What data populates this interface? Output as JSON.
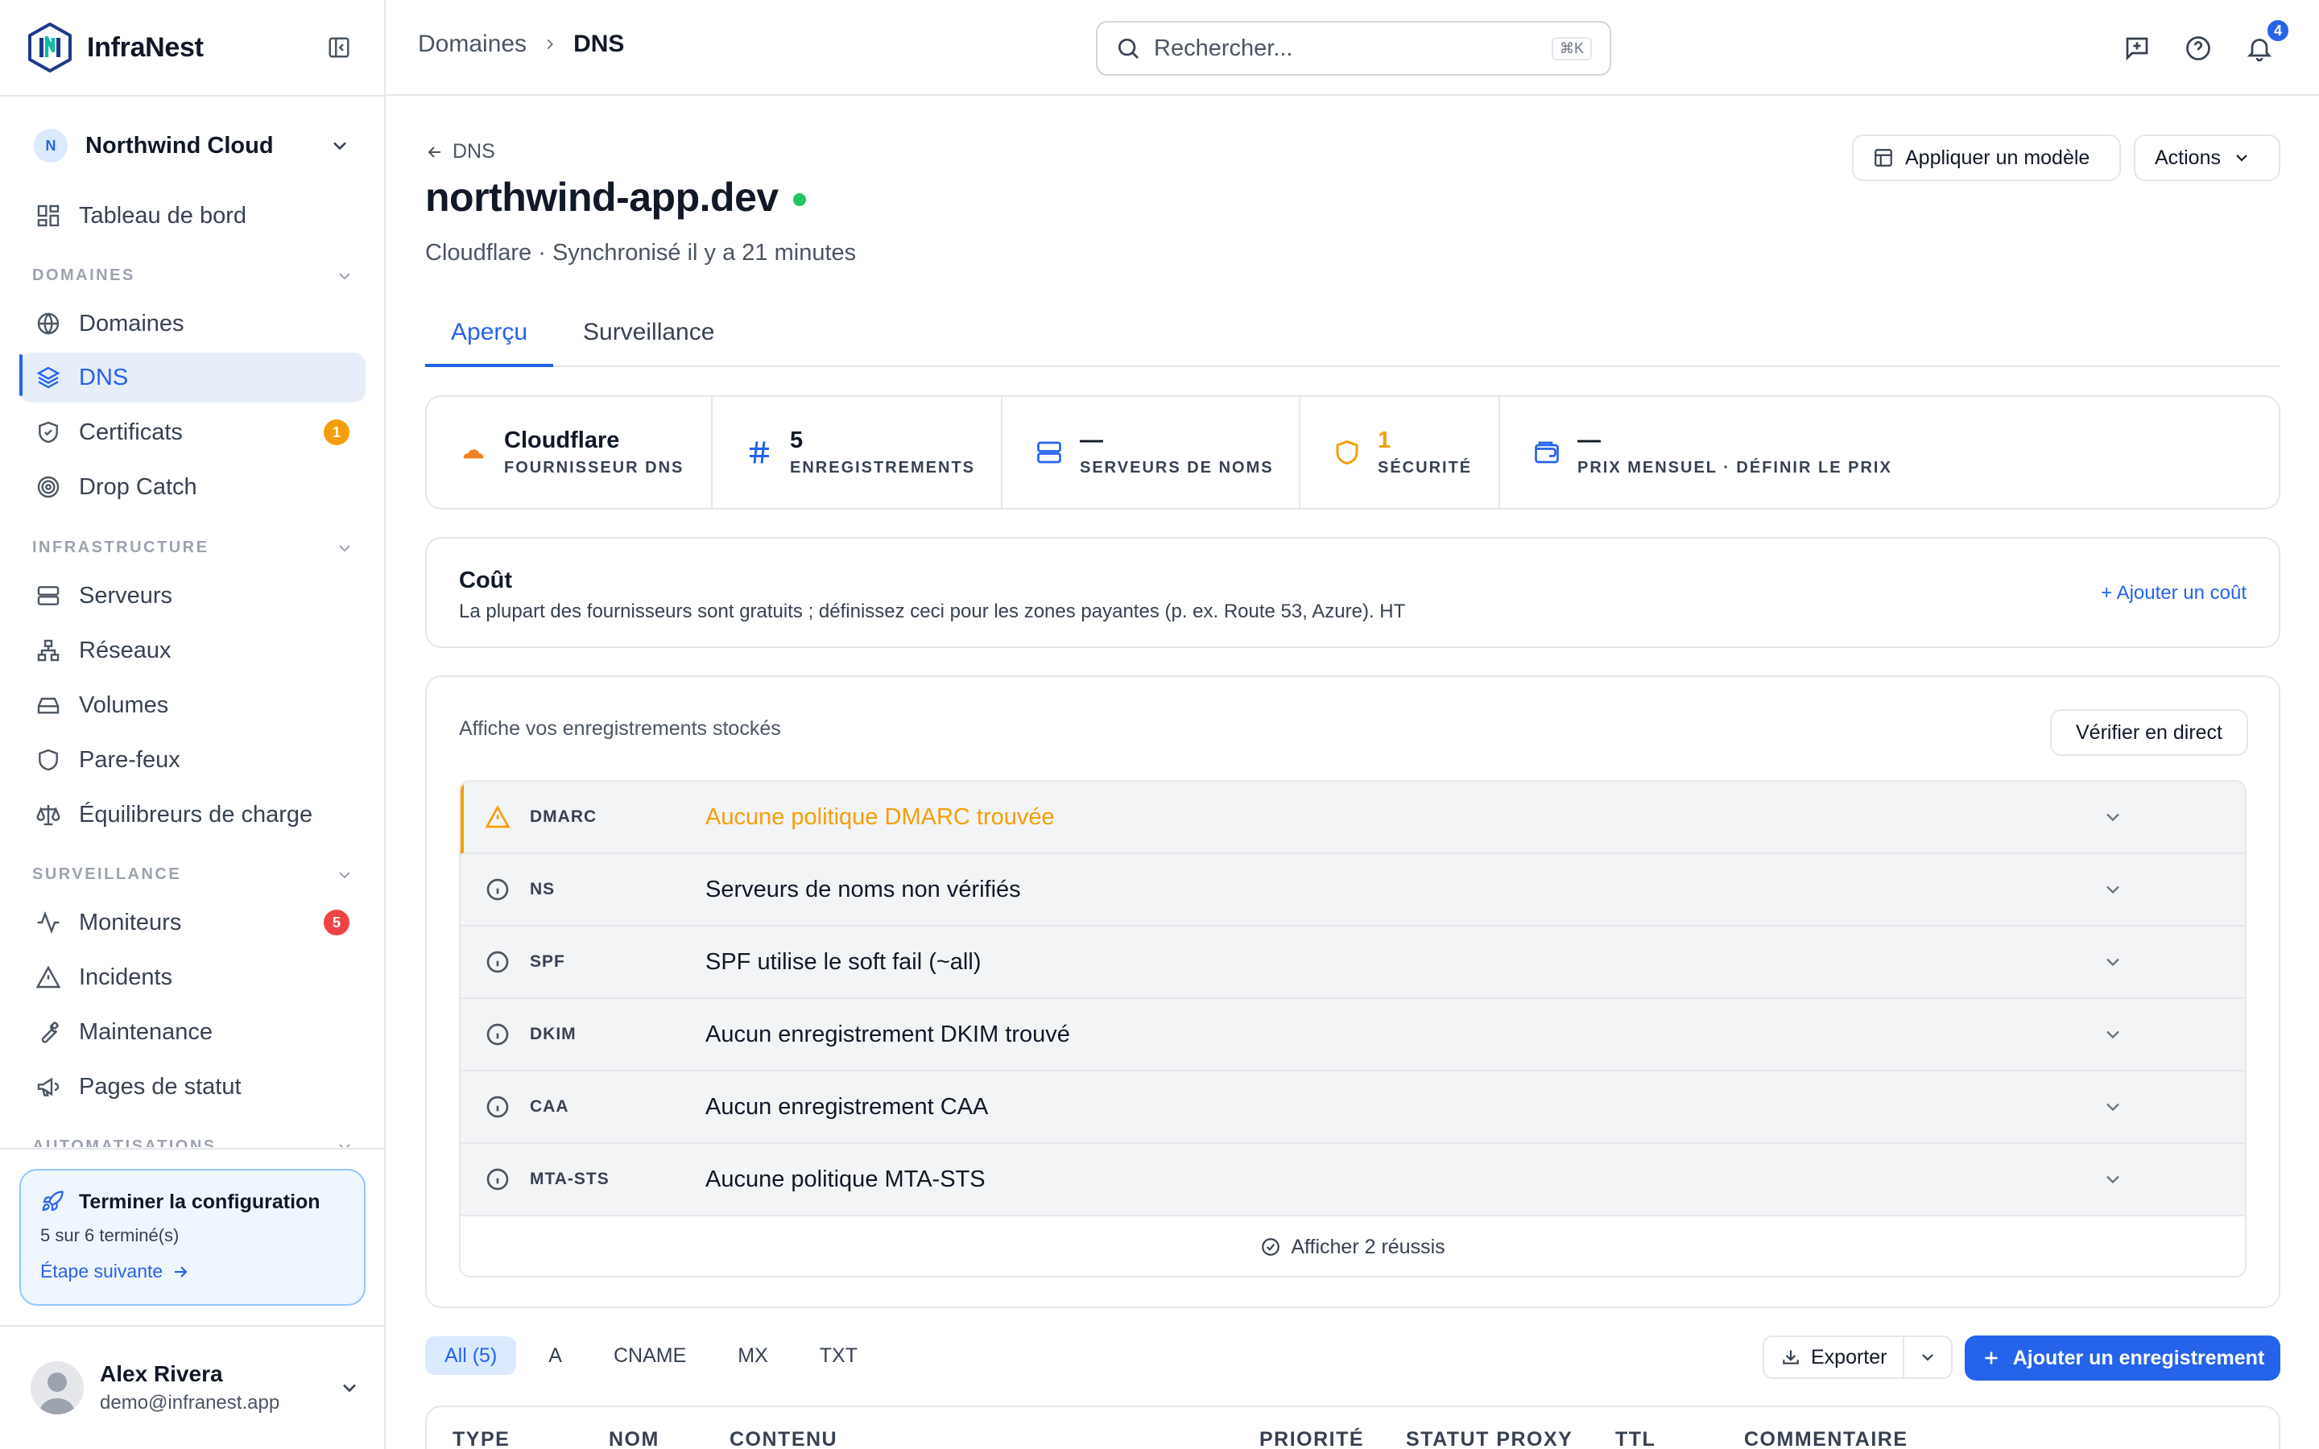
{
  "app": {
    "name": "InfraNest"
  },
  "org": {
    "initial": "N",
    "name": "Northwind Cloud"
  },
  "nav": {
    "dashboard": "Tableau de bord",
    "sections": {
      "domains": "DOMAINES",
      "infrastructure": "INFRASTRUCTURE",
      "monitoring": "SURVEILLANCE",
      "automations": "AUTOMATISATIONS"
    },
    "items": {
      "domains": "Domaines",
      "dns": "DNS",
      "certificates": "Certificats",
      "drop_catch": "Drop Catch",
      "servers": "Serveurs",
      "networks": "Réseaux",
      "volumes": "Volumes",
      "firewalls": "Pare-feux",
      "load_balancers": "Équilibreurs de charge",
      "monitors": "Moniteurs",
      "incidents": "Incidents",
      "maintenance": "Maintenance",
      "status_pages": "Pages de statut"
    },
    "badges": {
      "certificates": "1",
      "monitors": "5"
    }
  },
  "setup": {
    "title": "Terminer la configuration",
    "progress": "5 sur 6 terminé(s)",
    "next": "Étape suivante"
  },
  "user": {
    "name": "Alex Rivera",
    "email": "demo@infranest.app"
  },
  "breadcrumb": {
    "parent": "Domaines",
    "current": "DNS"
  },
  "search": {
    "placeholder": "Rechercher...",
    "shortcut": "⌘K"
  },
  "notifications": {
    "count": "4"
  },
  "page": {
    "back": "DNS",
    "title": "northwind-app.dev",
    "subtitle": "Cloudflare · Synchronisé il y a 21 minutes",
    "apply_template": "Appliquer un modèle",
    "actions": "Actions"
  },
  "tabs": {
    "overview": "Aperçu",
    "monitoring": "Surveillance"
  },
  "stats": {
    "provider": {
      "value": "Cloudflare",
      "label": "FOURNISSEUR DNS"
    },
    "records": {
      "value": "5",
      "label": "ENREGISTREMENTS"
    },
    "nameservers": {
      "value": "—",
      "label": "SERVEURS DE NOMS"
    },
    "security": {
      "value": "1",
      "label": "SÉCURITÉ"
    },
    "price": {
      "value": "—",
      "label": "PRIX MENSUEL · DÉFINIR LE PRIX"
    }
  },
  "cost": {
    "title": "Coût",
    "description": "La plupart des fournisseurs sont gratuits ; définissez ceci pour les zones payantes (p. ex. Route 53, Azure). HT",
    "add": "+ Ajouter un coût"
  },
  "audit": {
    "description": "Affiche vos enregistrements stockés",
    "verify": "Vérifier en direct",
    "rows": [
      {
        "key": "DMARC",
        "message": "Aucune politique DMARC trouvée"
      },
      {
        "key": "NS",
        "message": "Serveurs de noms non vérifiés"
      },
      {
        "key": "SPF",
        "message": "SPF utilise le soft fail (~all)"
      },
      {
        "key": "DKIM",
        "message": "Aucun enregistrement DKIM trouvé"
      },
      {
        "key": "CAA",
        "message": "Aucun enregistrement CAA"
      },
      {
        "key": "MTA-STS",
        "message": "Aucune politique MTA-STS"
      }
    ],
    "show_passed": "Afficher 2 réussis"
  },
  "filters": [
    "All (5)",
    "A",
    "CNAME",
    "MX",
    "TXT"
  ],
  "toolbar": {
    "export": "Exporter",
    "add_record": "Ajouter un enregistrement"
  },
  "table": {
    "columns": {
      "type": "TYPE",
      "name": "NOM",
      "content": "CONTENU",
      "priority": "PRIORITÉ",
      "proxy": "STATUT PROXY",
      "ttl": "TTL",
      "comment": "COMMENTAIRE"
    }
  },
  "colors": {
    "accent": "#2563eb",
    "warning": "#f59e0b",
    "danger": "#ef4444",
    "success": "#22c55e",
    "cloudflare": "#f38020"
  }
}
